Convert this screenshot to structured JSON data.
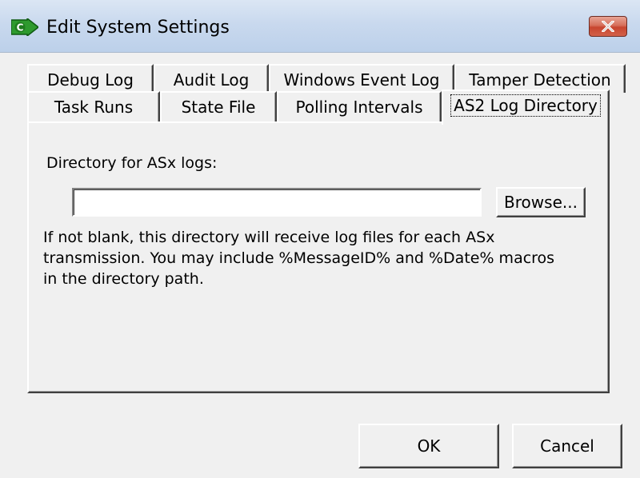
{
  "window": {
    "title": "Edit System Settings",
    "app_icon": "green-arrow-c-icon",
    "close_icon": "close-icon",
    "close_color": "#c7452f"
  },
  "tabs": {
    "row_back": [
      {
        "label": "Debug Log"
      },
      {
        "label": "Audit Log"
      },
      {
        "label": "Windows Event Log"
      },
      {
        "label": "Tamper Detection"
      }
    ],
    "row_front": [
      {
        "label": "Task Runs"
      },
      {
        "label": "State File"
      },
      {
        "label": "Polling Intervals"
      },
      {
        "label": "AS2 Log Directory"
      }
    ],
    "active": "AS2 Log Directory"
  },
  "panel": {
    "directory_label": "Directory for ASx logs:",
    "directory_value": "",
    "browse_label": "Browse...",
    "help_text": "If not blank, this directory will receive log files for each ASx\ntransmission.  You may include %MessageID% and %Date% macros\nin the directory path."
  },
  "footer": {
    "ok_label": "OK",
    "cancel_label": "Cancel"
  }
}
